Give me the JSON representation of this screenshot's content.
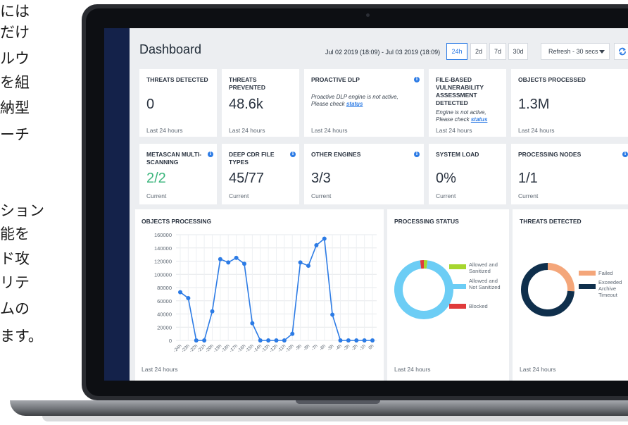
{
  "marketing_text": [
    "には",
    "だけ",
    "ルウ",
    "を組",
    "納型",
    "ーチ",
    "ション",
    "能を",
    "ド攻",
    "リテ",
    "ムの",
    "ます。"
  ],
  "dashboard": {
    "title": "Dashboard",
    "date_range": "Jul 02 2019 (18:09) - Jul 03 2019 (18:09)",
    "ranges": [
      "24h",
      "2d",
      "7d",
      "30d"
    ],
    "active_range": "24h",
    "refresh_label": "Refresh - 30 secs"
  },
  "stat_cards": [
    {
      "title": "THREATS DETECTED",
      "value": "0",
      "footer": "Last 24 hours"
    },
    {
      "title": "THREATS PREVENTED",
      "value": "48.6k",
      "footer": "Last 24 hours"
    },
    {
      "title": "PROACTIVE DLP",
      "note": "Proactive DLP engine is not active, Please check",
      "link": "status",
      "footer": "Last 24 hours"
    },
    {
      "title": "FILE-BASED VULNERABILITY ASSESSMENT DETECTED",
      "note": "Engine is not active, Please check",
      "link": "status",
      "footer": "Last 24 hours"
    },
    {
      "title": "OBJECTS PROCESSED",
      "value": "1.3M",
      "footer": "Last 24 hours"
    },
    {
      "title": "METASCAN MULTI-SCANNING",
      "value": "2/2",
      "footer": "Current"
    },
    {
      "title": "DEEP CDR FILE TYPES",
      "value": "45/77",
      "footer": "Current"
    },
    {
      "title": "OTHER ENGINES",
      "value": "3/3",
      "footer": "Current"
    },
    {
      "title": "SYSTEM LOAD",
      "value": "0%",
      "footer": "Current"
    },
    {
      "title": "PROCESSING NODES",
      "value": "1/1",
      "footer": "Current"
    }
  ],
  "panels": {
    "objects_processing": {
      "title": "OBJECTS PROCESSING",
      "footer": "Last 24 hours"
    },
    "processing_status": {
      "title": "PROCESSING STATUS",
      "footer": "Last 24 hours"
    },
    "threats_detected": {
      "title": "THREATS DETECTED",
      "footer": "Last 24 hours"
    }
  },
  "colors": {
    "accent": "#2c7be5",
    "nav": "#14224a",
    "green": "#3bb57c",
    "line": "#2c7be5",
    "allowed_sanitized": "#a6d62f",
    "allowed_not_sanitized": "#6ccdf5",
    "blocked": "#e03b3b",
    "failed": "#f4a67a",
    "exceeded": "#0f2f4c"
  },
  "chart_data": [
    {
      "type": "line",
      "title": "OBJECTS PROCESSING",
      "x": [
        "-24h",
        "-23h",
        "-22h",
        "-21h",
        "-20h",
        "-19h",
        "-18h",
        "-17h",
        "-16h",
        "-15h",
        "-14h",
        "-13h",
        "-12h",
        "-11h",
        "-10h",
        "-9h",
        "-8h",
        "-7h",
        "-6h",
        "-5h",
        "-4h",
        "-3h",
        "-2h",
        "-1h",
        "0h"
      ],
      "values": [
        73000,
        64000,
        0,
        0,
        44000,
        123000,
        118000,
        125000,
        116000,
        26000,
        0,
        0,
        0,
        0,
        10000,
        118000,
        113000,
        144000,
        154000,
        39000,
        0,
        0,
        0,
        0,
        0
      ],
      "ylim": [
        0,
        160000
      ],
      "yticks": [
        "160000",
        "140000",
        "120000",
        "100000",
        "80000",
        "60000",
        "40000",
        "20000",
        "0"
      ],
      "grid": true
    },
    {
      "type": "pie",
      "title": "PROCESSING STATUS",
      "labels": [
        "Allowed and Sanitized",
        "Allowed and Not Sanitized",
        "Blocked"
      ],
      "values": [
        2,
        96,
        2
      ]
    },
    {
      "type": "pie",
      "title": "THREATS DETECTED",
      "labels": [
        "Failed",
        "Exceeded Archive Timeout"
      ],
      "values": [
        26,
        74
      ]
    }
  ]
}
